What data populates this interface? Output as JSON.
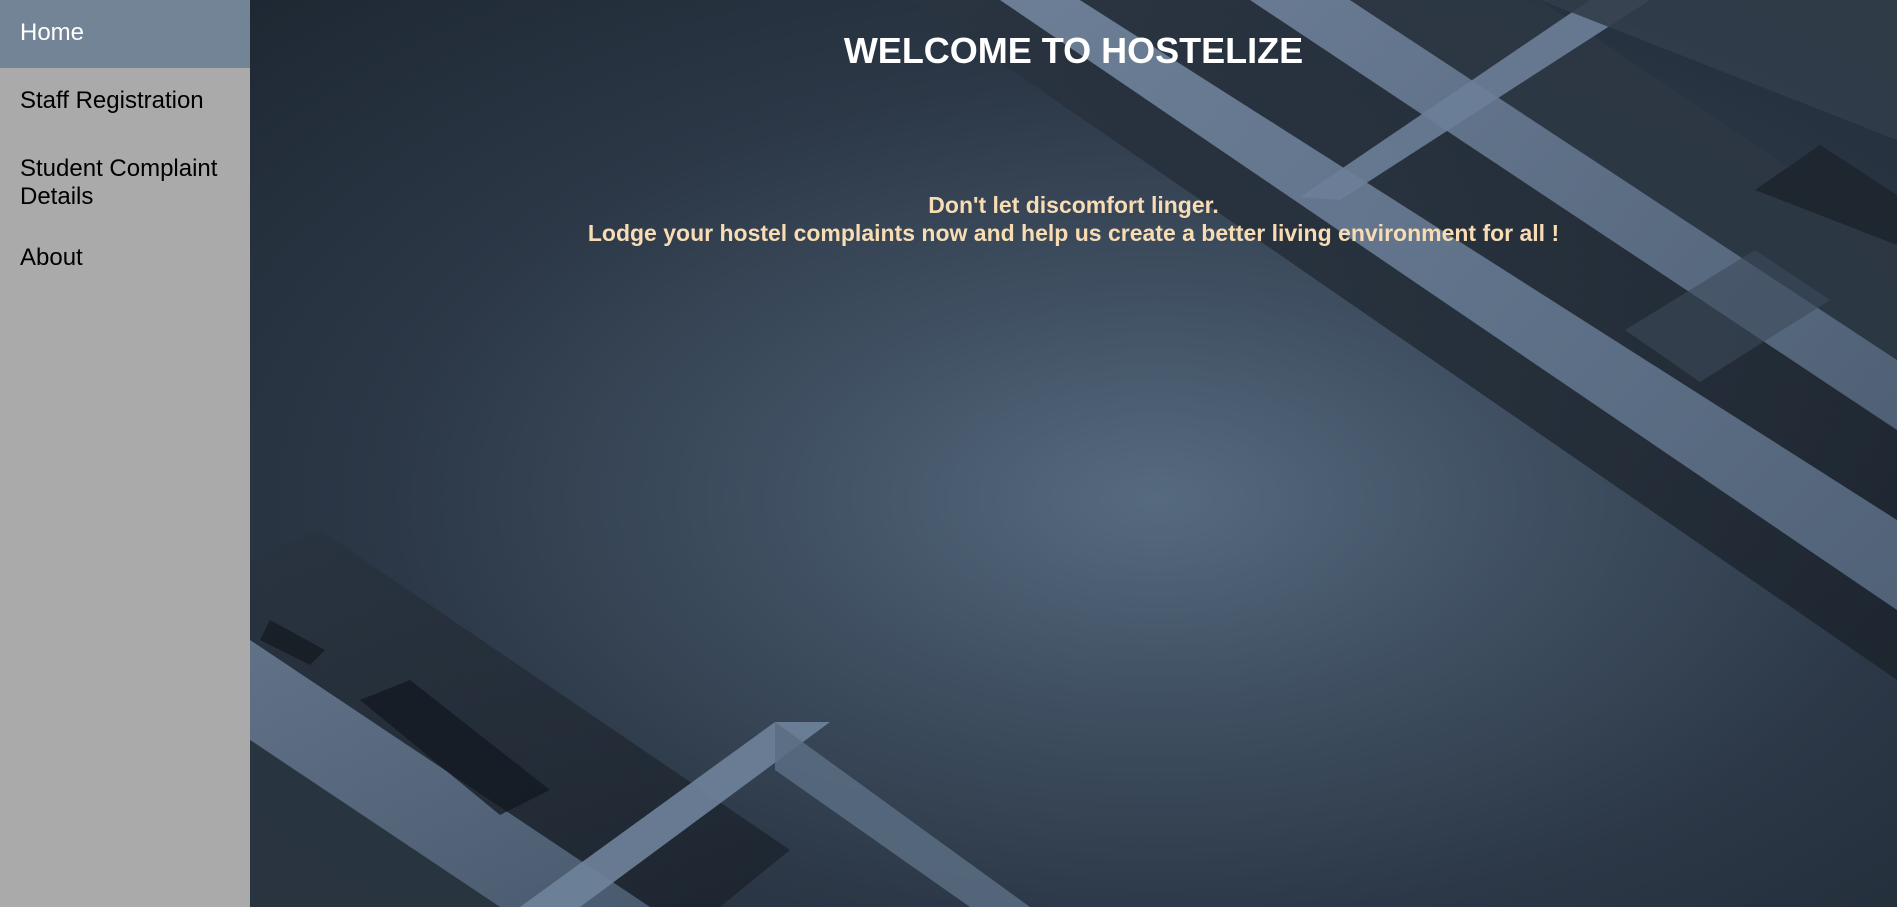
{
  "sidebar": {
    "items": [
      {
        "label": "Home",
        "active": true
      },
      {
        "label": "Staff Registration",
        "active": false
      },
      {
        "label": "Student Complaint Details",
        "active": false
      },
      {
        "label": "About",
        "active": false
      }
    ]
  },
  "main": {
    "title": "WELCOME TO HOSTELIZE",
    "tagline_line1": "Don't let discomfort linger.",
    "tagline_line2": "Lodge your hostel complaints now and help us create a better living environment for all !"
  },
  "colors": {
    "sidebar_bg": "#aaaaaa",
    "active_item_bg": "#728496",
    "title_color": "#ffffff",
    "tagline_color": "#f8dcb4"
  }
}
